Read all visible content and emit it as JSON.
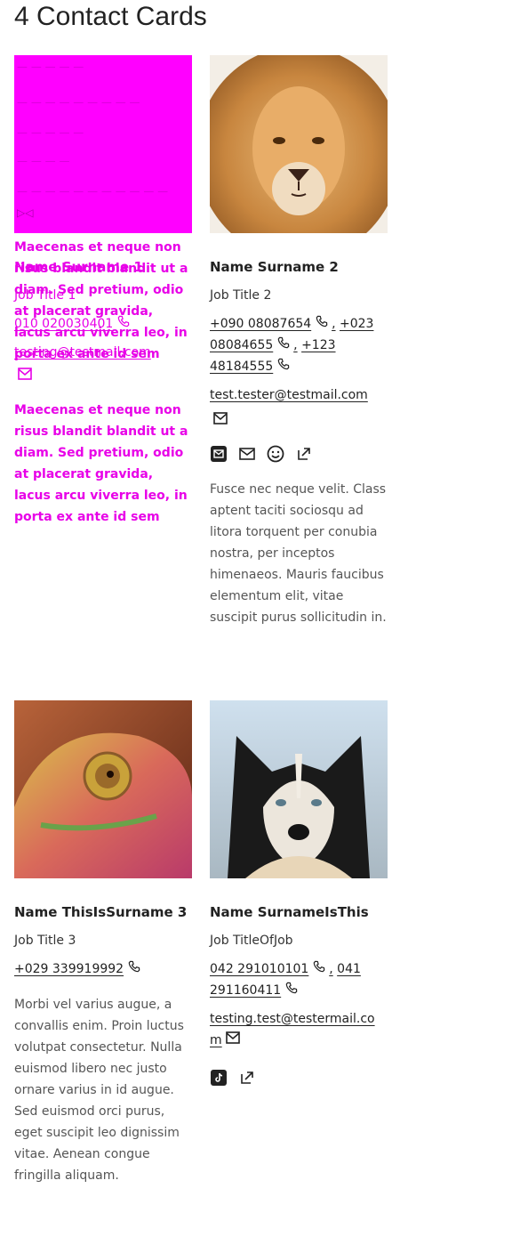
{
  "page": {
    "title": "4 Contact Cards"
  },
  "cards": [
    {
      "name": "Name Surname 1",
      "job_title": "Job Title 1",
      "phone": "010 020030401",
      "email": "testing@testmail.com",
      "overlay_text": "Maecenas et neque non risus blandit blandit ut a diam. Sed pretium, odio at placerat gravida, lacus arcu viverra leo, in porta ex ante id sem",
      "description": "Maecenas et neque non risus blandit blandit ut a diam. Sed pretium, odio at placerat gravida, lacus arcu viverra leo, in porta ex ante id sem",
      "accent": "#ff00ff"
    },
    {
      "name": "Name Surname 2",
      "job_title": "Job Title 2",
      "phones": [
        "+090 08087654",
        "+023 08084655",
        "+123 48184555"
      ],
      "separator": ",",
      "email": "test.tester@testmail.com",
      "socials": [
        "mail-box-icon",
        "envelope-icon",
        "smiley-icon",
        "external-link-icon"
      ],
      "description": "Fusce nec neque velit. Class aptent taciti sociosqu ad litora torquent per conubia nostra, per inceptos himenaeos. Mauris faucibus elementum elit, vitae suscipit purus sollicitudin in.",
      "photo": "lion"
    },
    {
      "name": "Name ThisIsSurname 3",
      "job_title": "Job Title 3",
      "phone": "+029 339919992",
      "description": "Morbi vel varius augue, a convallis enim. Proin luctus volutpat consectetur. Nulla euismod libero nec justo ornare varius in id augue. Sed euismod orci purus, eget suscipit leo dignissim vitae. Aenean congue fringilla aliquam.",
      "photo": "chameleon"
    },
    {
      "name": "Name SurnameIsThis",
      "job_title": "Job TitleOfJob",
      "phones": [
        "042 291010101",
        "041 291160411"
      ],
      "separator": ",",
      "email_part1": "testing.test@testermail.co",
      "email_part2": "m",
      "socials": [
        "tiktok-icon",
        "external-link-icon"
      ],
      "photo": "husky"
    }
  ]
}
